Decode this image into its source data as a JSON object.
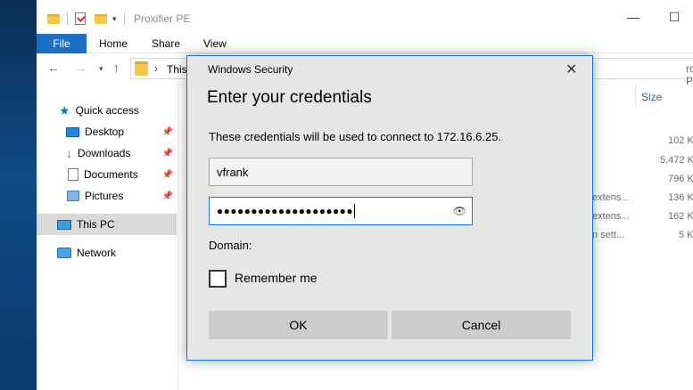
{
  "explorer": {
    "window_title": "Proxifier PE",
    "ribbon_tabs": [
      "File",
      "Home",
      "Share",
      "View"
    ],
    "address": {
      "path_fragment": "This",
      "search_fragment": "roxifier PE"
    },
    "nav_pane": {
      "items": [
        {
          "label": "Quick access",
          "icon": "star-icon",
          "pinned": false
        },
        {
          "label": "Desktop",
          "icon": "desktop-icon",
          "pinned": true
        },
        {
          "label": "Downloads",
          "icon": "download-icon",
          "pinned": true
        },
        {
          "label": "Documents",
          "icon": "document-icon",
          "pinned": true
        },
        {
          "label": "Pictures",
          "icon": "pictures-icon",
          "pinned": true
        },
        {
          "label": "This PC",
          "icon": "computer-icon",
          "pinned": false,
          "selected": true
        },
        {
          "label": "Network",
          "icon": "network-icon",
          "pinned": false
        }
      ]
    },
    "content": {
      "size_header": "Size",
      "type_fragments": [
        "extens...",
        "extens...",
        "n sett..."
      ],
      "sizes": [
        "102 K",
        "5,472 K",
        "796 K",
        "136 K",
        "162 K",
        "5 K"
      ]
    }
  },
  "dialog": {
    "caption": "Windows Security",
    "heading": "Enter your credentials",
    "message": "These credentials will be used to connect to 172.16.6.25.",
    "username_value": "vfrank",
    "password_dots": "●●●●●●●●●●●●●●●●●●●●",
    "domain_label": "Domain:",
    "remember_label": "Remember me",
    "remember_checked": false,
    "ok_label": "OK",
    "cancel_label": "Cancel"
  },
  "colors": {
    "accent": "#1a73d9",
    "file_tab": "#1a6fc4",
    "dialog_bg": "#e6e6e6",
    "button_bg": "#cccccc"
  }
}
